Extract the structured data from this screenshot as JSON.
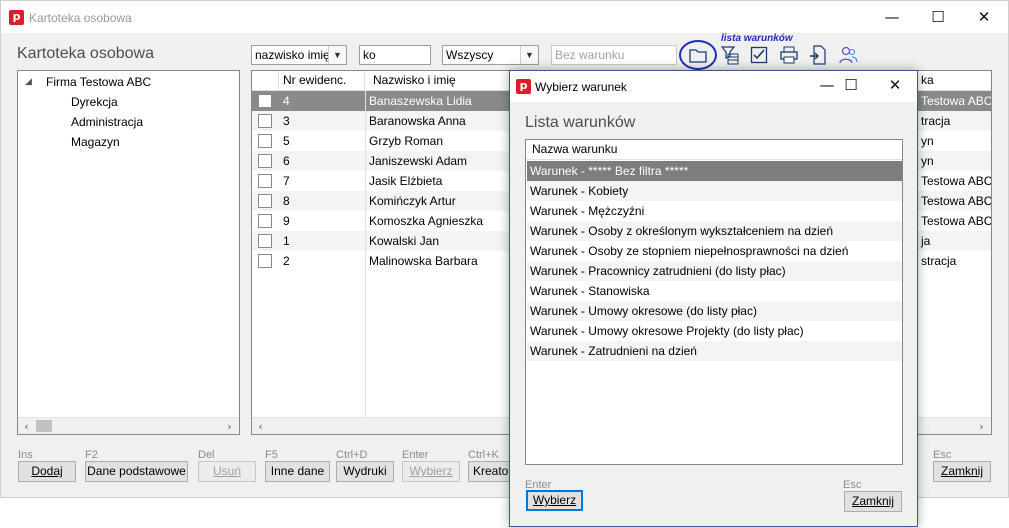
{
  "window": {
    "title": "Kartoteka osobowa",
    "controls": {
      "minimize": "—",
      "maximize": "☐",
      "close": "✕"
    }
  },
  "main": {
    "heading": "Kartoteka osobowa",
    "sort_combo": "nazwisko imię",
    "search_value": "ko",
    "filter_combo": "Wszyscy",
    "condition_placeholder": "Bez warunku",
    "annotation": "lista warunków",
    "toolbar_icons": [
      "folder-icon",
      "filter-list-icon",
      "checkbox-icon",
      "printer-icon",
      "export-icon",
      "people-icon"
    ]
  },
  "tree": {
    "root": "Firma Testowa ABC",
    "root_toggle": "◢",
    "children": [
      "Dyrekcja",
      "Administracja",
      "Magazyn"
    ]
  },
  "grid": {
    "columns": [
      "Nr ewidenc.",
      "Nazwisko i imię",
      "ka"
    ],
    "rows": [
      {
        "nr": "4",
        "name": "Banaszewska Lidia",
        "unit": "Testowa ABC"
      },
      {
        "nr": "3",
        "name": "Baranowska Anna",
        "unit": "tracja"
      },
      {
        "nr": "5",
        "name": "Grzyb Roman",
        "unit": "yn"
      },
      {
        "nr": "6",
        "name": "Janiszewski Adam",
        "unit": "yn"
      },
      {
        "nr": "7",
        "name": "Jasik Elżbieta",
        "unit": "Testowa ABC"
      },
      {
        "nr": "8",
        "name": "Komińczyk Artur",
        "unit": "Testowa ABC"
      },
      {
        "nr": "9",
        "name": "Komoszka Agnieszka",
        "unit": "Testowa ABC"
      },
      {
        "nr": "1",
        "name": "Kowalski Jan",
        "unit": "ja"
      },
      {
        "nr": "2",
        "name": "Malinowska Barbara",
        "unit": "stracja"
      }
    ]
  },
  "buttons": [
    {
      "hint": "Ins",
      "label": "Dodaj",
      "key": "add"
    },
    {
      "hint": "F2",
      "label": "Dane podstawowe",
      "key": "basic-data"
    },
    {
      "hint": "Del",
      "label": "Usuń",
      "key": "delete"
    },
    {
      "hint": "F5",
      "label": "Inne dane",
      "key": "other-data"
    },
    {
      "hint": "Ctrl+D",
      "label": "Wydruki",
      "key": "prints"
    },
    {
      "hint": "Enter",
      "label": "Wybierz",
      "key": "select"
    },
    {
      "hint": "Ctrl+K",
      "label": "Kreator",
      "key": "creator"
    },
    {
      "hint": "Esc",
      "label": "Zamknij",
      "key": "close"
    }
  ],
  "dialog": {
    "title": "Wybierz warunek",
    "heading": "Lista warunków",
    "column_header": "Nazwa warunku",
    "items": [
      "Warunek - ***** Bez filtra *****",
      "Warunek - Kobiety",
      "Warunek - Mężczyźni",
      "Warunek - Osoby z określonym wykształceniem na dzień",
      "Warunek - Osoby ze stopniem niepełnosprawności na dzień",
      "Warunek - Pracownicy zatrudnieni (do listy płac)",
      "Warunek - Stanowiska",
      "Warunek - Umowy okresowe (do listy płac)",
      "Warunek - Umowy okresowe Projekty (do listy płac)",
      "Warunek - Zatrudnieni na dzień"
    ],
    "select_hint": "Enter",
    "select_label": "Wybierz",
    "close_hint": "Esc",
    "close_label": "Zamknij"
  }
}
